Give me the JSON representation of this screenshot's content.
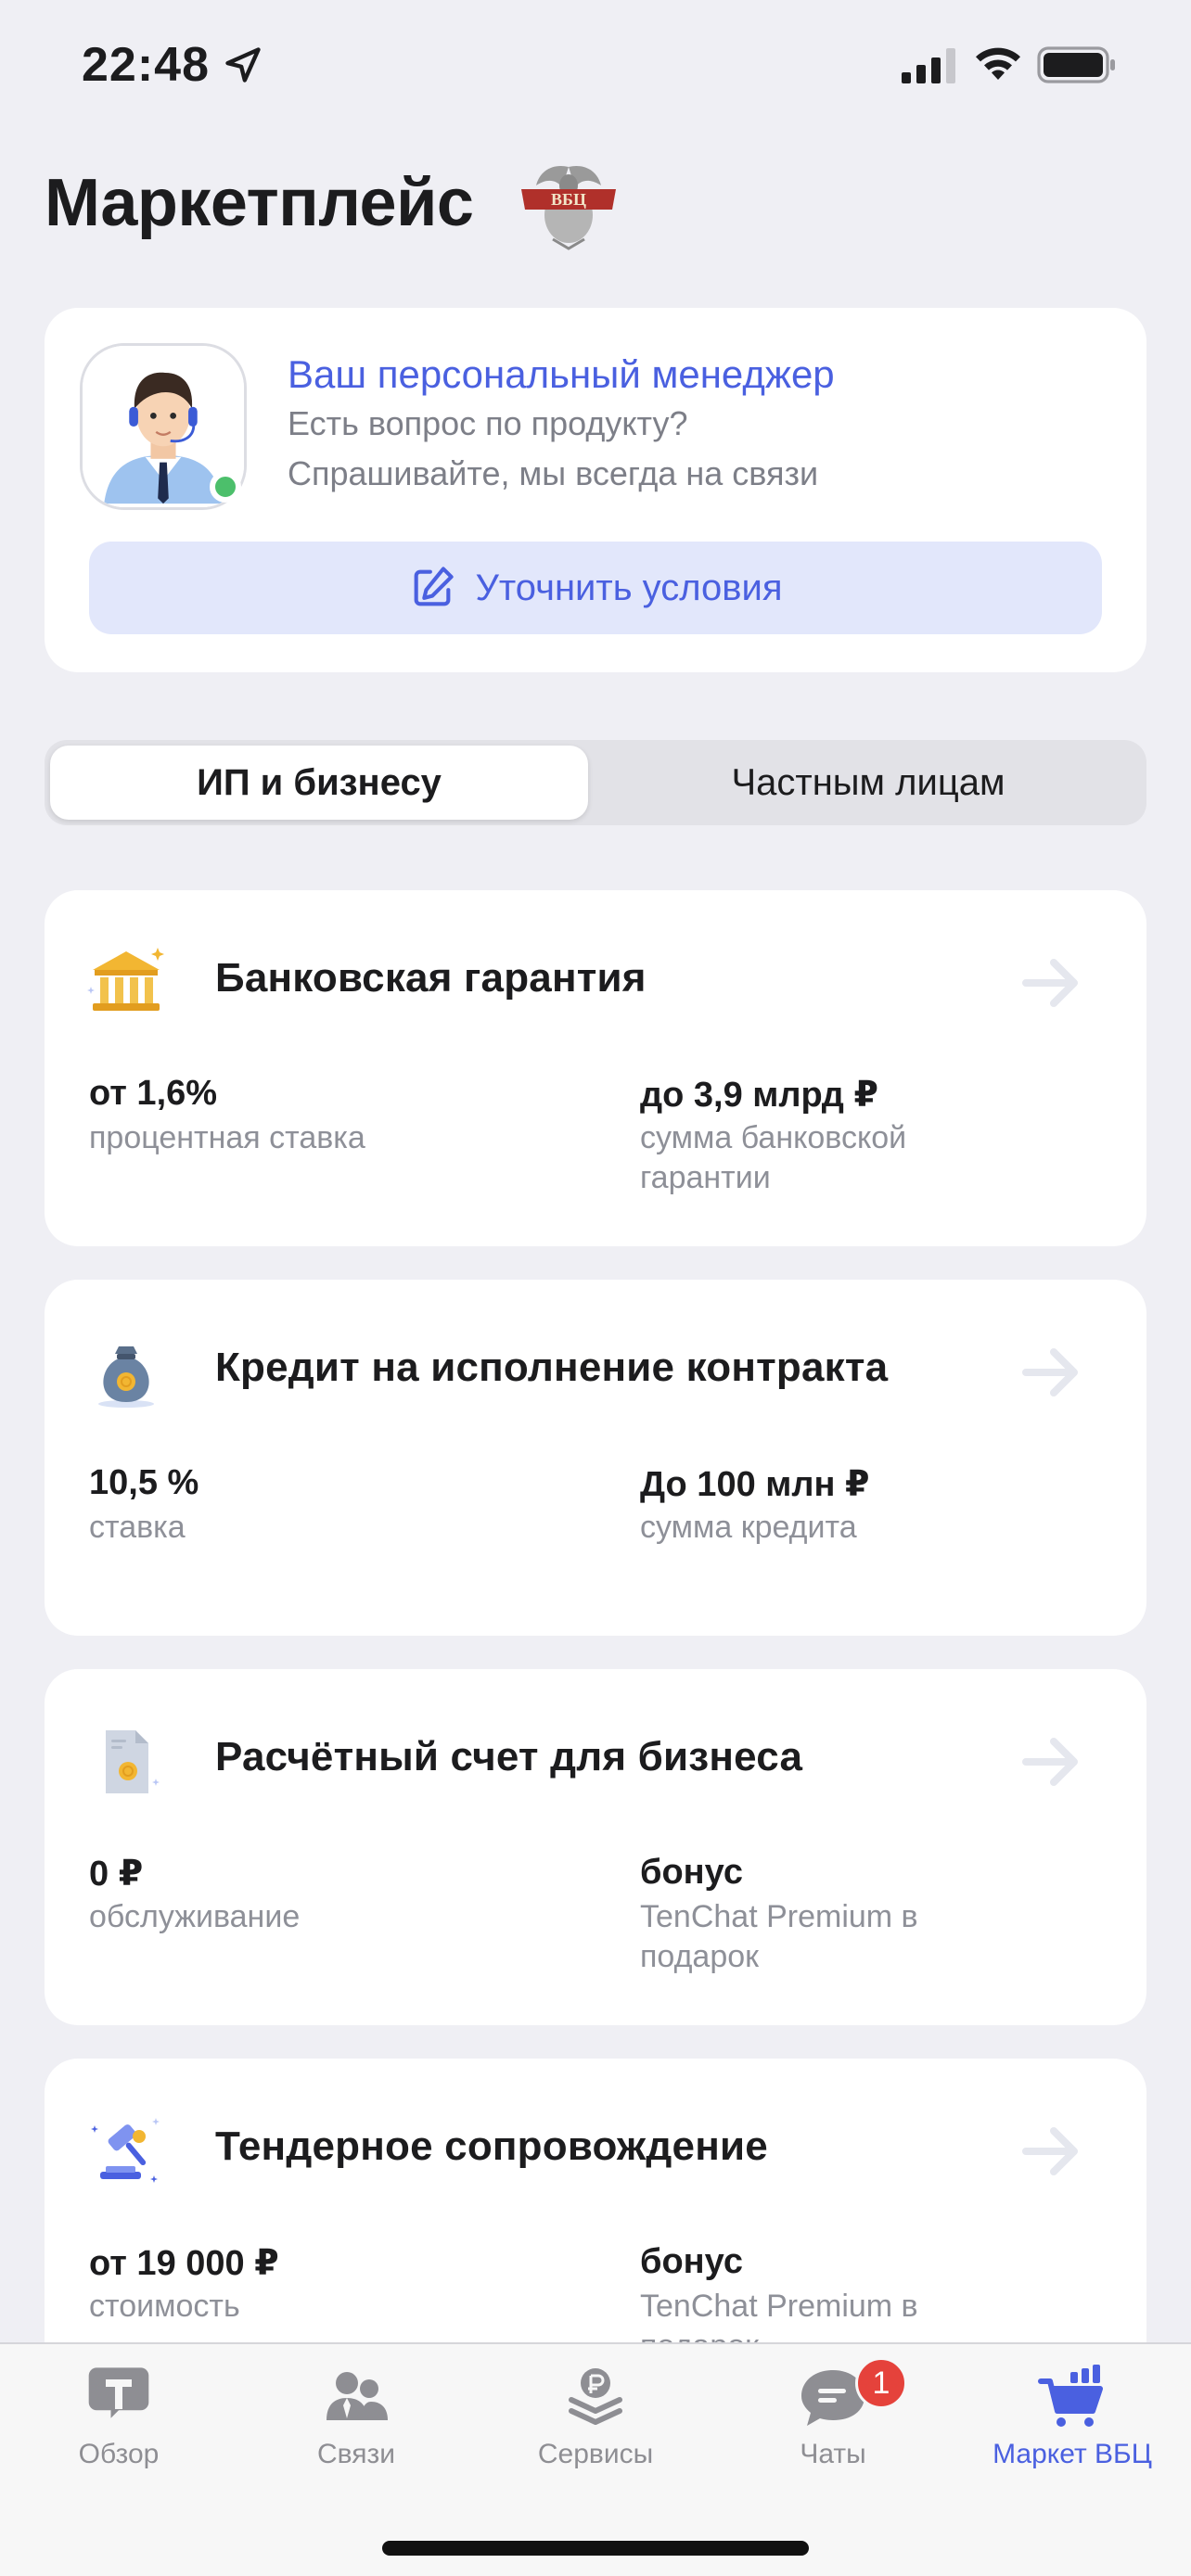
{
  "status_bar": {
    "time": "22:48"
  },
  "page": {
    "title": "Маркетплейс",
    "logo_text": "ВБЦ"
  },
  "manager_card": {
    "title": "Ваш персональный менеджер",
    "line1": "Есть вопрос по продукту?",
    "line2": "Спрашивайте, мы всегда на связи",
    "button_label": "Уточнить условия",
    "online_status_color": "#4cbf6b"
  },
  "segments": {
    "active": "ИП и бизнесу",
    "inactive": "Частным лицам"
  },
  "products": [
    {
      "title": "Банковская гарантия",
      "icon": "bank-icon",
      "left_value": "от 1,6%",
      "left_caption": "процентная ставка",
      "right_value": "до 3,9 млрд ₽",
      "right_caption": "сумма банковской гарантии"
    },
    {
      "title": "Кредит на исполнение контракта",
      "icon": "money-bag-icon",
      "left_value": "10,5 %",
      "left_caption": "ставка",
      "right_value": "До 100 млн ₽",
      "right_caption": "сумма кредита"
    },
    {
      "title": "Расчётный счет для бизнеса",
      "icon": "document-coin-icon",
      "left_value": "0 ₽",
      "left_caption": "обслуживание",
      "right_value": "бонус",
      "right_caption": "TenChat Premium в подарок"
    },
    {
      "title": "Тендерное сопровождение",
      "icon": "gavel-icon",
      "left_value": "от 19 000 ₽",
      "left_caption": "стоимость",
      "right_value": "бонус",
      "right_caption": "TenChat Premium в подарок"
    }
  ],
  "tab_bar": {
    "tabs": [
      {
        "label": "Обзор",
        "icon": "t-logo-icon"
      },
      {
        "label": "Связи",
        "icon": "people-icon"
      },
      {
        "label": "Сервисы",
        "icon": "ruble-stack-icon"
      },
      {
        "label": "Чаты",
        "icon": "chat-icon",
        "badge": "1"
      },
      {
        "label": "Маркет ВБЦ",
        "icon": "cart-icon",
        "active": true
      }
    ]
  },
  "colors": {
    "accent": "#4a60e0",
    "background": "#efeff4",
    "badge": "#e5423b"
  }
}
